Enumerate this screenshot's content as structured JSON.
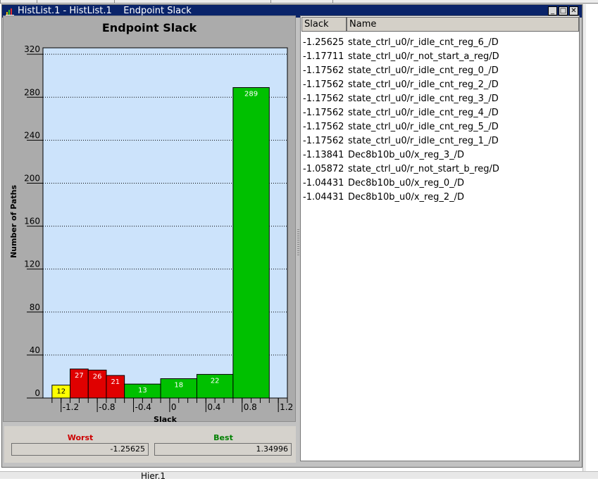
{
  "window": {
    "title": "HistList.1 - HistList.1    Endpoint Slack",
    "minimize_glyph": "_",
    "maximize_glyph": "□",
    "close_glyph": "✕"
  },
  "chart_data": {
    "type": "bar",
    "title": "Endpoint Slack",
    "xlabel": "Slack",
    "ylabel": "Number of Paths",
    "x_range": [
      -1.4,
      1.3
    ],
    "ylim": [
      0,
      326
    ],
    "yticks": [
      0,
      40,
      80,
      120,
      160,
      200,
      240,
      280,
      320
    ],
    "xticks": [
      -1.2,
      -0.8,
      -0.4,
      0,
      0.4,
      0.8,
      1.2
    ],
    "xtick_labels": [
      "-1.2",
      "-0.8",
      "-0.4",
      "0",
      "0.4",
      "0.8",
      "1.2"
    ],
    "bins": [
      {
        "x0": -1.3,
        "x1": -1.1,
        "value": 12,
        "color": "#ffff00"
      },
      {
        "x0": -1.1,
        "x1": -0.9,
        "value": 27,
        "color": "#e00000"
      },
      {
        "x0": -0.9,
        "x1": -0.7,
        "value": 26,
        "color": "#e00000"
      },
      {
        "x0": -0.7,
        "x1": -0.5,
        "value": 21,
        "color": "#e00000"
      },
      {
        "x0": -0.5,
        "x1": -0.1,
        "value": 13,
        "color": "#00c000"
      },
      {
        "x0": -0.1,
        "x1": 0.3,
        "value": 18,
        "color": "#00c000"
      },
      {
        "x0": 0.3,
        "x1": 0.7,
        "value": 22,
        "color": "#00c000"
      },
      {
        "x0": 0.7,
        "x1": 1.1,
        "value": 289,
        "color": "#00c000"
      }
    ],
    "bin_label_color_light": "#000000",
    "bin_label_color_dark": "#ffffff",
    "plot_background": "#cce3fb",
    "grid": "dotted horizontal"
  },
  "legend": {
    "worst_label": "Worst",
    "best_label": "Best",
    "worst_value": "-1.25625",
    "best_value": "1.34996",
    "worst_color": "#cc0000",
    "best_color": "#008000"
  },
  "table": {
    "columns": [
      "Slack",
      "Name"
    ],
    "rows": [
      {
        "slack": "-1.25625",
        "name": "state_ctrl_u0/r_idle_cnt_reg_6_/D"
      },
      {
        "slack": "-1.17711",
        "name": "state_ctrl_u0/r_not_start_a_reg/D"
      },
      {
        "slack": "-1.17562",
        "name": "state_ctrl_u0/r_idle_cnt_reg_0_/D"
      },
      {
        "slack": "-1.17562",
        "name": "state_ctrl_u0/r_idle_cnt_reg_2_/D"
      },
      {
        "slack": "-1.17562",
        "name": "state_ctrl_u0/r_idle_cnt_reg_3_/D"
      },
      {
        "slack": "-1.17562",
        "name": "state_ctrl_u0/r_idle_cnt_reg_4_/D"
      },
      {
        "slack": "-1.17562",
        "name": "state_ctrl_u0/r_idle_cnt_reg_5_/D"
      },
      {
        "slack": "-1.17562",
        "name": "state_ctrl_u0/r_idle_cnt_reg_1_/D"
      },
      {
        "slack": "-1.13841",
        "name": "Dec8b10b_u0/x_reg_3_/D"
      },
      {
        "slack": "-1.05872",
        "name": "state_ctrl_u0/r_not_start_b_reg/D"
      },
      {
        "slack": "-1.04431",
        "name": "Dec8b10b_u0/x_reg_0_/D"
      },
      {
        "slack": "-1.04431",
        "name": "Dec8b10b_u0/x_reg_2_/D"
      }
    ]
  },
  "status": {
    "text": "Hier.1"
  }
}
